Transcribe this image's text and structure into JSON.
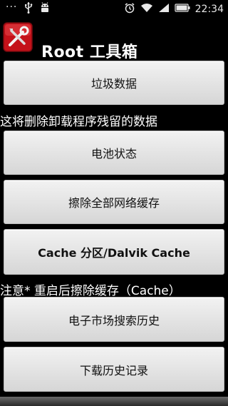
{
  "status_bar": {
    "left_icons": [
      "overflow-dots-icon",
      "usb-icon",
      "android-debug-icon"
    ],
    "right_icons": [
      "alarm-icon",
      "wifi-icon",
      "signal-icon",
      "battery-icon"
    ],
    "time": "22:34",
    "overflow": "···"
  },
  "app": {
    "title": "Root 工具箱",
    "icon": "tools-icon",
    "accent": "#d71920"
  },
  "buttons": [
    {
      "label": "垃圾数据"
    },
    {
      "label": "电池状态"
    },
    {
      "label": "擦除全部网络缓存"
    },
    {
      "label": "Cache 分区/Dalvik Cache"
    },
    {
      "label": "电子市场搜索历史"
    },
    {
      "label": "下载历史记录"
    }
  ],
  "notes": {
    "junk_note": "这将删除卸载程序残留的数据",
    "cache_note": "注意* 重启后擦除缓存（Cache）"
  }
}
